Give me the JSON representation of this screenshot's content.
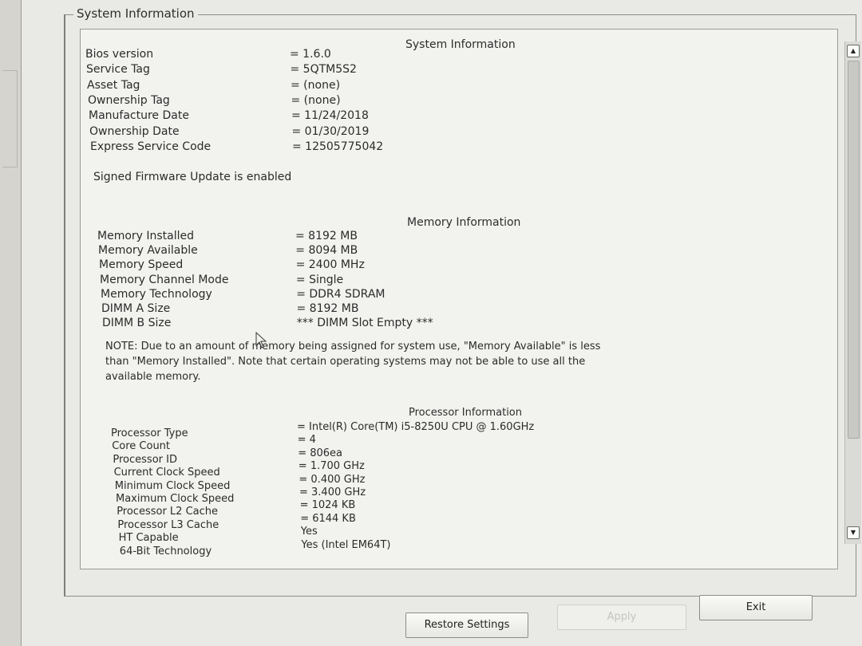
{
  "window": {
    "group_title": "System Information"
  },
  "system": {
    "title": "System Information",
    "rows": [
      {
        "label": "Bios version",
        "value": "= 1.6.0"
      },
      {
        "label": "Service Tag",
        "value": "= 5QTM5S2"
      },
      {
        "label": "Asset Tag",
        "value": "= (none)"
      },
      {
        "label": "Ownership Tag",
        "value": "= (none)"
      },
      {
        "label": "Manufacture Date",
        "value": "= 11/24/2018"
      },
      {
        "label": "Ownership Date",
        "value": "= 01/30/2019"
      },
      {
        "label": "Express Service Code",
        "value": "= 12505775042"
      }
    ],
    "signed": "Signed Firmware Update is enabled"
  },
  "memory": {
    "title": "Memory Information",
    "rows": [
      {
        "label": "Memory Installed",
        "value": "= 8192 MB"
      },
      {
        "label": "Memory Available",
        "value": "= 8094 MB"
      },
      {
        "label": "Memory Speed",
        "value": "= 2400 MHz"
      },
      {
        "label": "Memory Channel Mode",
        "value": "= Single"
      },
      {
        "label": "Memory Technology",
        "value": "= DDR4 SDRAM"
      },
      {
        "label": "DIMM A Size",
        "value": "= 8192 MB"
      },
      {
        "label": "DIMM B Size",
        "value": "*** DIMM Slot Empty ***"
      }
    ],
    "note_line1": "NOTE: Due to an amount of memory being assigned for system use, \"Memory Available\" is less",
    "note_line2": "than \"Memory Installed\". Note that certain operating systems may not be able to use all the",
    "note_line3": "available memory."
  },
  "processor": {
    "title": "Processor Information",
    "rows": [
      {
        "label": "Processor Type",
        "value": "= Intel(R) Core(TM) i5-8250U CPU @ 1.60GHz"
      },
      {
        "label": "Core Count",
        "value": "= 4"
      },
      {
        "label": "Processor ID",
        "value": "= 806ea"
      },
      {
        "label": "Current Clock Speed",
        "value": "= 1.700 GHz"
      },
      {
        "label": "Minimum Clock Speed",
        "value": "= 0.400 GHz"
      },
      {
        "label": "Maximum Clock Speed",
        "value": "= 3.400 GHz"
      },
      {
        "label": "Processor L2 Cache",
        "value": "= 1024 KB"
      },
      {
        "label": "Processor L3 Cache",
        "value": "= 6144 KB"
      },
      {
        "label": "HT Capable",
        "value": "Yes"
      },
      {
        "label": "64-Bit Technology",
        "value": "Yes (Intel EM64T)"
      }
    ]
  },
  "buttons": {
    "restore": "Restore Settings",
    "apply": "Apply",
    "exit": "Exit"
  },
  "icons": {
    "scroll_up": "scroll-up-arrow-icon",
    "scroll_down": "scroll-down-arrow-icon",
    "cursor": "mouse-pointer-icon"
  }
}
